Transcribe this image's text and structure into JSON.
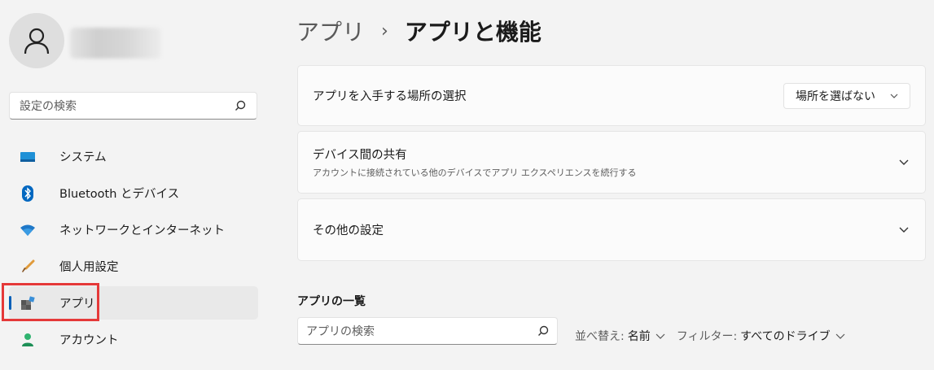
{
  "user": {
    "avatar_icon": "person-icon"
  },
  "search": {
    "placeholder": "設定の検索",
    "icon": "search-icon"
  },
  "nav": {
    "items": [
      {
        "label": "システム",
        "icon": "system-icon"
      },
      {
        "label": "Bluetooth とデバイス",
        "icon": "bluetooth-icon"
      },
      {
        "label": "ネットワークとインターネット",
        "icon": "wifi-icon"
      },
      {
        "label": "個人用設定",
        "icon": "brush-icon"
      },
      {
        "label": "アプリ",
        "icon": "apps-icon",
        "active": true
      },
      {
        "label": "アカウント",
        "icon": "account-icon"
      }
    ]
  },
  "breadcrumb": {
    "parent": "アプリ",
    "separator": "›",
    "current": "アプリと機能"
  },
  "settings": {
    "install_source": {
      "title": "アプリを入手する場所の選択",
      "value": "場所を選ばない"
    },
    "share": {
      "title": "デバイス間の共有",
      "subtitle": "アカウントに接続されている他のデバイスでアプリ エクスペリエンスを続行する"
    },
    "other": {
      "title": "その他の設定"
    }
  },
  "app_list": {
    "heading": "アプリの一覧",
    "search_placeholder": "アプリの検索",
    "sort_label": "並べ替え:",
    "sort_value": "名前",
    "filter_label": "フィルター:",
    "filter_value": "すべてのドライブ"
  },
  "colors": {
    "accent": "#005fb8",
    "highlight": "#e53939",
    "background": "#f3f3f3"
  }
}
